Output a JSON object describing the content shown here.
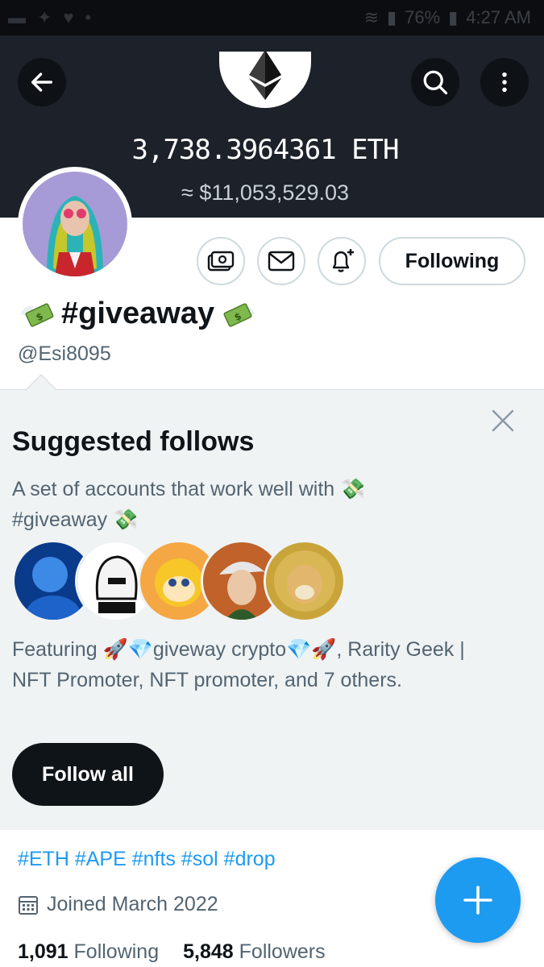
{
  "status_bar": {
    "battery": "76%",
    "time": "4:27 AM"
  },
  "header": {
    "eth_amount": "3,738.3964361 ETH",
    "usd_amount": "≈ $11,053,529.03",
    "icons": [
      "back-arrow-icon",
      "ethereum-icon",
      "search-icon",
      "more-vertical-icon"
    ]
  },
  "profile": {
    "following_button": "Following",
    "display_name": "#giveaway",
    "handle": "@Esi8095",
    "action_icons": [
      "tip-money-icon",
      "mail-icon",
      "notification-bell-icon"
    ]
  },
  "suggested": {
    "title": "Suggested follows",
    "description_part1": "A set of accounts that work well with",
    "description_part2": "#giveaway",
    "featuring_line1": "Featuring 🚀💎giveway crypto💎🚀, Rarity Geek |",
    "featuring_line2": "NFT Promoter, NFT promoter, and 7 others.",
    "follow_all": "Follow all",
    "avatar_count": 5
  },
  "bio": {
    "hashtags": "#ETH #APE #nfts #sol #drop",
    "joined": "Joined March 2022",
    "following_count": "1,091",
    "following_label": "Following",
    "followers_count": "5,848",
    "followers_label": "Followers"
  },
  "colors": {
    "header_bg": "#1c212a",
    "accent_blue": "#1d9bf0",
    "panel_bg": "#eff3f4",
    "text_primary": "#0f1419",
    "text_secondary": "#536471"
  }
}
